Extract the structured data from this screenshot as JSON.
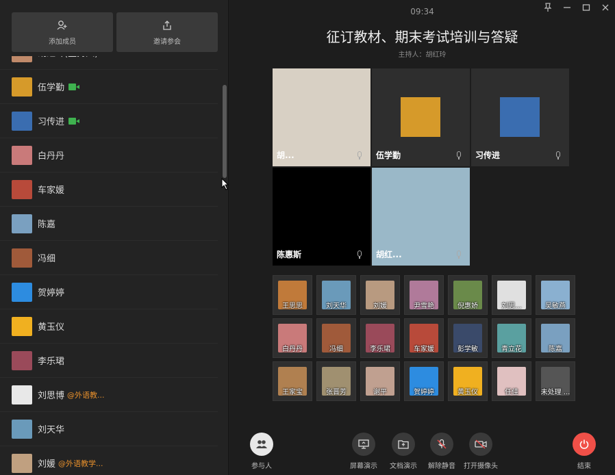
{
  "left_panel": {
    "add_member_label": "添加成员",
    "invite_label": "邀请参会",
    "members": [
      {
        "name": "胡红玲(主持人)",
        "camera": true,
        "org": "",
        "avatar_color": "#c08a6a"
      },
      {
        "name": "伍学勤",
        "camera": true,
        "org": "",
        "avatar_color": "#d69a2a"
      },
      {
        "name": "习传进",
        "camera": true,
        "org": "",
        "avatar_color": "#3a6db0"
      },
      {
        "name": "白丹丹",
        "camera": false,
        "org": "",
        "avatar_color": "#c97a7a"
      },
      {
        "name": "车家媛",
        "camera": false,
        "org": "",
        "avatar_color": "#b84a3a"
      },
      {
        "name": "陈嘉",
        "camera": false,
        "org": "",
        "avatar_color": "#7aa0c0"
      },
      {
        "name": "冯细",
        "camera": false,
        "org": "",
        "avatar_color": "#a05a3a"
      },
      {
        "name": "贺婷婷",
        "camera": false,
        "org": "",
        "avatar_color": "#2d8ce0"
      },
      {
        "name": "黄玉仪",
        "camera": false,
        "org": "",
        "avatar_color": "#f0b020"
      },
      {
        "name": "李乐珺",
        "camera": false,
        "org": "",
        "avatar_color": "#9a4a5a"
      },
      {
        "name": "刘思博",
        "camera": false,
        "org": "@外语教...",
        "avatar_color": "#e8e8e8"
      },
      {
        "name": "刘天华",
        "camera": false,
        "org": "",
        "avatar_color": "#6a9aba"
      },
      {
        "name": "刘媛",
        "camera": false,
        "org": "@外语教学...",
        "avatar_color": "#c0a080"
      }
    ]
  },
  "header": {
    "time": "09:34",
    "title": "征订教材、期末考试培训与答疑",
    "host_line": "主持人：胡红玲"
  },
  "videos": [
    {
      "name": "胡...",
      "bg": "#d8d0c4"
    },
    {
      "name": "伍学勤",
      "bg": "#2e2e2e",
      "avatar_color": "#d69a2a"
    },
    {
      "name": "习传进",
      "bg": "#2e2e2e",
      "avatar_color": "#3a6db0"
    },
    {
      "name": "陈惠斯",
      "bg": "#000000"
    },
    {
      "name": "胡红...",
      "bg": "#9ab8c8"
    }
  ],
  "thumbnails": [
    {
      "name": "王思思",
      "color": "#c07a3a"
    },
    {
      "name": "刘天华",
      "color": "#6a9aba"
    },
    {
      "name": "刘媛",
      "color": "#b89a80"
    },
    {
      "name": "尹雪艳",
      "color": "#b07a9a"
    },
    {
      "name": "倪惠娇",
      "color": "#6a8a4a"
    },
    {
      "name": "刘思...",
      "color": "#e0e0e0"
    },
    {
      "name": "吴敏燕",
      "color": "#8ab0d0"
    },
    {
      "name": "白丹丹",
      "color": "#c97a7a"
    },
    {
      "name": "冯细",
      "color": "#a05a3a"
    },
    {
      "name": "李乐珺",
      "color": "#9a4a5a"
    },
    {
      "name": "车家媛",
      "color": "#b84a3a"
    },
    {
      "name": "彭学敏",
      "color": "#3a4a6a"
    },
    {
      "name": "青立花",
      "color": "#5aa0a0"
    },
    {
      "name": "陈嘉",
      "color": "#7aa0c0"
    },
    {
      "name": "王家宝",
      "color": "#b08050"
    },
    {
      "name": "张晋芳",
      "color": "#a09070"
    },
    {
      "name": "谢平",
      "color": "#c0a090"
    },
    {
      "name": "贺婷婷",
      "color": "#2d8ce0"
    },
    {
      "name": "黄玉仪",
      "color": "#f0b020"
    },
    {
      "name": "任佳",
      "color": "#e0c0c0"
    },
    {
      "name": "未处理 ...",
      "color": "#555555"
    }
  ],
  "bottom_bar": {
    "participants_label": "参与人",
    "screen_share_label": "屏幕演示",
    "doc_share_label": "文档演示",
    "unmute_label": "解除静音",
    "camera_label": "打开摄像头",
    "end_label": "结束"
  },
  "colors": {
    "camera_on": "#3fb24f",
    "org_text": "#e8902c",
    "end_button": "#f05048"
  }
}
